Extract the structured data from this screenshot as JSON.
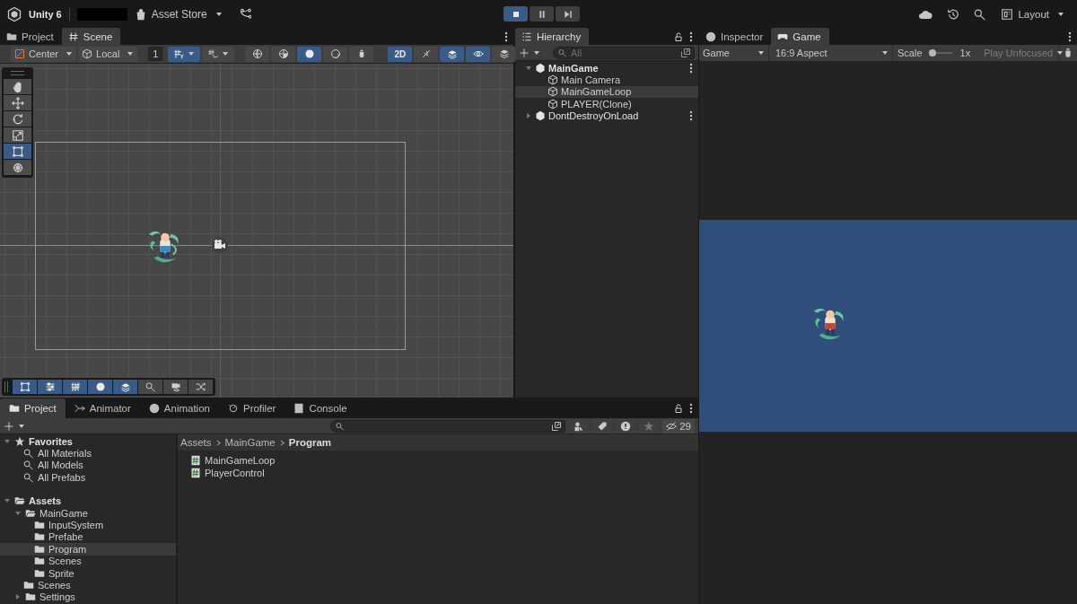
{
  "topbar": {
    "product": "Unity 6",
    "store": "Asset Store",
    "layout": "Layout"
  },
  "play_controls": [
    {
      "kind": "stop",
      "selected": true
    },
    {
      "kind": "pause",
      "selected": false
    },
    {
      "kind": "step",
      "selected": false
    }
  ],
  "scene_panel": {
    "tabs": [
      {
        "label": "Project",
        "kind": "folder",
        "selected": false
      },
      {
        "label": "Scene",
        "kind": "hash",
        "selected": true
      }
    ],
    "pivot": "Center",
    "space": "Local",
    "grid_size": "1",
    "snap_buttons": [
      {
        "kind": "grid-snap",
        "selected": true
      },
      {
        "kind": "increment-snap",
        "selected": false
      }
    ],
    "render_buttons": [
      {
        "kind": "wireframe",
        "selected": false
      },
      {
        "kind": "shaded-wireframe",
        "selected": false
      },
      {
        "kind": "shaded",
        "selected": true
      },
      {
        "kind": "unlit",
        "selected": false
      },
      {
        "kind": "bug",
        "selected": false
      }
    ],
    "mode_2d": {
      "label": "2D",
      "selected": true
    },
    "view_buttons": [
      {
        "kind": "light-off",
        "selected": false
      },
      {
        "kind": "layers",
        "selected": true
      },
      {
        "kind": "eye",
        "selected": true
      },
      {
        "kind": "stack",
        "selected": false
      }
    ],
    "tools": [
      {
        "kind": "hand",
        "selected": false
      },
      {
        "kind": "move",
        "selected": false
      },
      {
        "kind": "rotate",
        "selected": false
      },
      {
        "kind": "scale",
        "selected": false
      },
      {
        "kind": "rect",
        "selected": true
      },
      {
        "kind": "transform",
        "selected": false
      }
    ],
    "overlay_tools": [
      {
        "kind": "rect",
        "selected": true
      },
      {
        "kind": "sliders",
        "selected": true
      },
      {
        "kind": "grid-hatch",
        "selected": true
      },
      {
        "kind": "shaded",
        "selected": true
      },
      {
        "kind": "layers",
        "selected": true
      },
      {
        "kind": "search",
        "selected": false
      },
      {
        "kind": "camera-eye",
        "selected": false
      },
      {
        "kind": "shuffle",
        "selected": false
      }
    ]
  },
  "hierarchy": {
    "title": "Hierarchy",
    "search_placeholder": "All",
    "tree": [
      {
        "label": "MainGame",
        "kind": "scene",
        "active": true,
        "expanded": true,
        "selected": false,
        "children": [
          {
            "label": "Main Camera",
            "kind": "object",
            "selected": false
          },
          {
            "label": "MainGameLoop",
            "kind": "object",
            "selected": true
          },
          {
            "label": "PLAYER(Clone)",
            "kind": "object",
            "selected": false
          }
        ]
      },
      {
        "label": "DontDestroyOnLoad",
        "kind": "scene",
        "active": false,
        "expanded": false,
        "selected": false
      }
    ]
  },
  "game_panel": {
    "tabs": [
      {
        "label": "Inspector",
        "kind": "info",
        "selected": false
      },
      {
        "label": "Game",
        "kind": "gamepad",
        "selected": true
      }
    ],
    "display": "Game",
    "aspect": "16:9 Aspect",
    "scale": {
      "label": "Scale",
      "reading": "1x"
    },
    "play_mode": "Play Unfocused"
  },
  "project_panel": {
    "tabs": [
      {
        "label": "Project",
        "kind": "folder",
        "selected": true
      },
      {
        "label": "Animator",
        "kind": "animator",
        "selected": false
      },
      {
        "label": "Animation",
        "kind": "clock",
        "selected": false
      },
      {
        "label": "Profiler",
        "kind": "gauge",
        "selected": false
      },
      {
        "label": "Console",
        "kind": "console",
        "selected": false
      }
    ],
    "hidden_count": "29",
    "tree": [
      {
        "label": "Favorites",
        "kind": "star",
        "expanded": true,
        "selected": false,
        "children": [
          {
            "label": "All Materials",
            "kind": "search",
            "selected": false
          },
          {
            "label": "All Models",
            "kind": "search",
            "selected": false
          },
          {
            "label": "All Prefabs",
            "kind": "search",
            "selected": false
          }
        ]
      },
      {
        "label": "Assets",
        "kind": "folder-open",
        "expanded": true,
        "selected": false,
        "children": [
          {
            "label": "MainGame",
            "kind": "folder-open",
            "expanded": true,
            "selected": false,
            "children": [
              {
                "label": "InputSystem",
                "kind": "folder",
                "selected": false
              },
              {
                "label": "Prefabe",
                "kind": "folder",
                "selected": false
              },
              {
                "label": "Program",
                "kind": "folder",
                "selected": true
              },
              {
                "label": "Scenes",
                "kind": "folder",
                "selected": false
              },
              {
                "label": "Sprite",
                "kind": "folder",
                "selected": false
              }
            ]
          },
          {
            "label": "Scenes",
            "kind": "folder",
            "selected": false
          },
          {
            "label": "Settings",
            "kind": "folder",
            "expanded": false,
            "selected": false
          }
        ]
      }
    ],
    "breadcrumb": [
      "Assets",
      "MainGame",
      "Program"
    ],
    "files": [
      "MainGameLoop",
      "PlayerControl"
    ]
  }
}
